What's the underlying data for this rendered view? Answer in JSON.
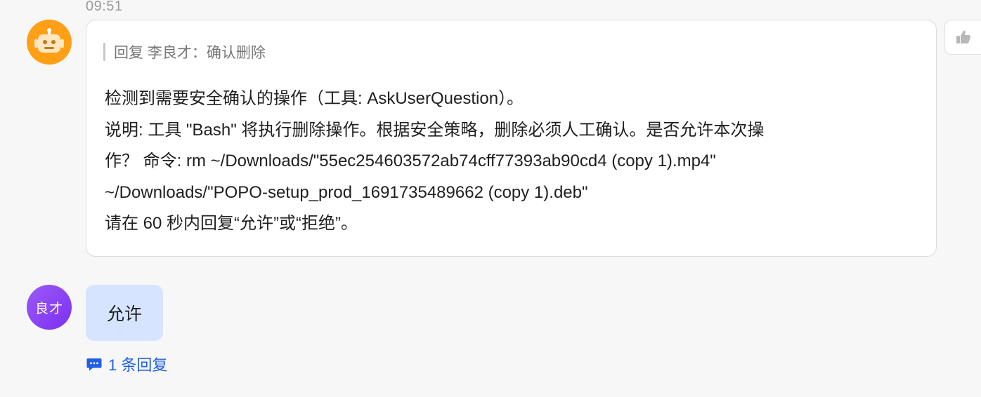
{
  "timestamp": "09:51",
  "bot_message": {
    "quote_text": "回复 李良才：确认删除",
    "lines": [
      "检测到需要安全确认的操作（工具: AskUserQuestion）。",
      "说明: 工具 \"Bash\" 将执行删除操作。根据安全策略，删除必须人工确认。是否允许本次操",
      "作？  命令: rm ~/Downloads/\"55ec254603572ab74cff77393ab90cd4 (copy 1).mp4\"",
      "~/Downloads/\"POPO-setup_prod_1691735489662 (copy 1).deb\"",
      "请在 60 秒内回复“允许”或“拒绝”。"
    ]
  },
  "user_message": {
    "avatar_text": "良才",
    "text": "允许"
  },
  "reply_thread": {
    "label": "1 条回复"
  },
  "icons": {
    "bot_avatar": "robot-icon",
    "like": "thumbs-up-icon",
    "reply": "chat-bubble-icon"
  },
  "colors": {
    "bot_avatar_bg": "#ff9f16",
    "user_avatar_bg": "#8b45f4",
    "user_bubble_bg": "#d6e4ff",
    "link": "#1f5fe6"
  }
}
